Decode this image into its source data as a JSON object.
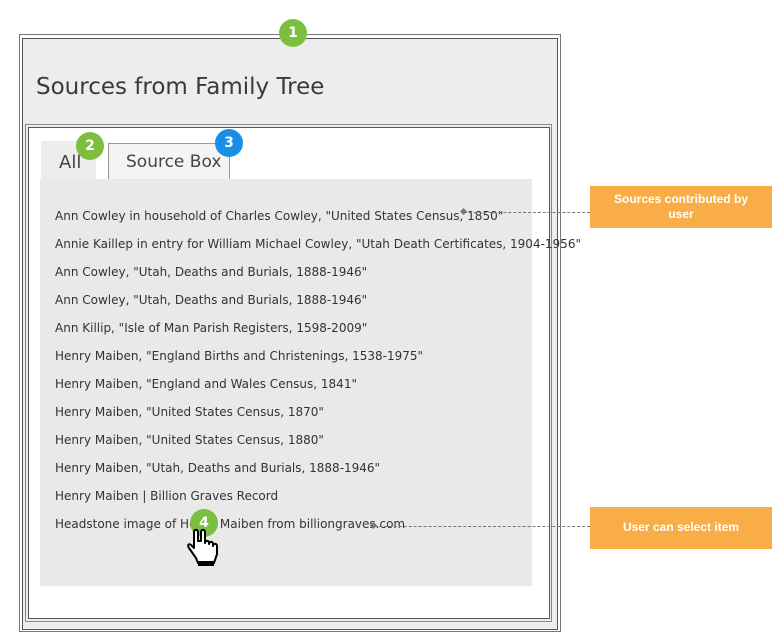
{
  "page": {
    "title": "Sources from Family Tree"
  },
  "tabs": [
    {
      "label": "All",
      "selected": true
    },
    {
      "label": "Source Box",
      "selected": false
    }
  ],
  "sources": [
    "Ann Cowley in household of Charles Cowley, \"United States Census, 1850\"",
    "Annie Kaillep in entry for William Michael Cowley, \"Utah Death Certificates, 1904-1956\"",
    "Ann Cowley, \"Utah, Deaths and Burials, 1888-1946\"",
    "Ann Cowley, \"Utah, Deaths and Burials, 1888-1946\"",
    "Ann Killip, \"Isle of Man Parish Registers, 1598-2009\"",
    "Henry Maiben, \"England Births and Christenings, 1538-1975\"",
    "Henry Maiben, \"England and Wales Census, 1841\"",
    "Henry Maiben, \"United States Census, 1870\"",
    "Henry Maiben, \"United States Census, 1880\"",
    "Henry Maiben, \"Utah, Deaths and Burials, 1888-1946\"",
    "Henry Maiben | Billion Graves Record",
    "Headstone image of Henry Maiben from billiongraves.com"
  ],
  "badges": {
    "b1": "1",
    "b2": "2",
    "b3": "3",
    "b4": "4"
  },
  "callouts": {
    "contributed": "Sources contributed by user",
    "select": "User can select item"
  },
  "colors": {
    "badge_green": "#7cbf3e",
    "badge_blue": "#1a8ee6",
    "callout_orange": "#f8ad47"
  },
  "icons": {
    "cursor": "hand-pointer-icon"
  }
}
